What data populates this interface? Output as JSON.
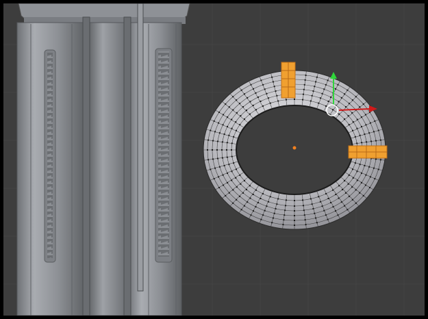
{
  "viewport": {
    "mode": "edit-mode",
    "background_color": "#3d3d3d",
    "grid_color": "#444444",
    "selection_color": "#f0a030",
    "mesh_color": "#cfcfd4",
    "wire_color": "#1a1a1a"
  },
  "objects": [
    {
      "name": "cylinder-machinery",
      "selected": false
    },
    {
      "name": "torus",
      "selected": false,
      "selected_faces": 2
    }
  ],
  "gizmo": {
    "type": "translate",
    "x_axis_color": "#d01a1a",
    "y_axis_color": "#2fd63a",
    "pivot": "3d-cursor"
  },
  "origin": {
    "color": "#f08020"
  }
}
